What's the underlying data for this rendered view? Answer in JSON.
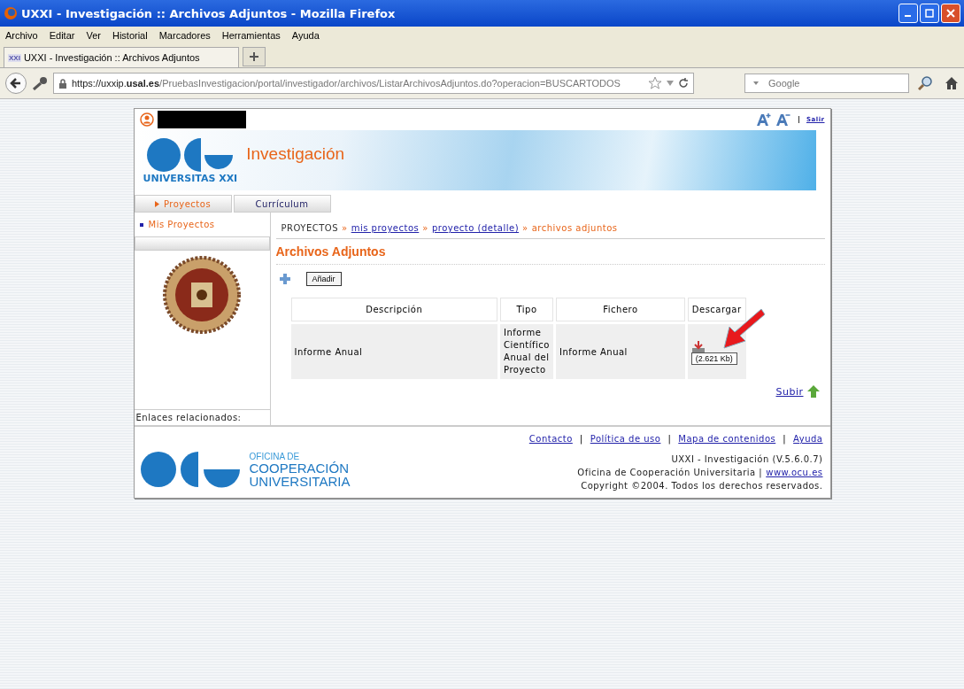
{
  "window": {
    "title": "UXXI - Investigación :: Archivos Adjuntos - Mozilla Firefox"
  },
  "menu": [
    "Archivo",
    "Editar",
    "Ver",
    "Historial",
    "Marcadores",
    "Herramientas",
    "Ayuda"
  ],
  "tabs": [
    {
      "label": "UXXI - Investigación :: Archivos Adjuntos",
      "selected": true
    }
  ],
  "tab_icon": "XXI",
  "address": {
    "prefix": "https://uxxip.",
    "domain": "usal.es",
    "path": "/PruebasInvestigacion/portal/investigador/archivos/ListarArchivosAdjuntos.do?operacion=BUSCARTODOS"
  },
  "search": {
    "placeholder": "Google"
  },
  "page": {
    "top_links": [
      "Salir"
    ],
    "banner": {
      "app_name": "Investigación",
      "logo_text": "UNIVERSITAS XXI"
    },
    "nav_tabs": [
      {
        "label": "Proyectos",
        "selected": true
      },
      {
        "label": "Currículum",
        "selected": false
      }
    ],
    "sidebar": {
      "items": [
        {
          "label": "Mis Proyectos"
        }
      ],
      "related": "Enlaces relacionados:"
    },
    "breadcrumb": [
      {
        "label": "PROYECTOS",
        "kind": "root"
      },
      {
        "label": "mis proyectos",
        "kind": "link"
      },
      {
        "label": "proyecto (detalle)",
        "kind": "link"
      },
      {
        "label": "archivos adjuntos",
        "kind": "current"
      }
    ],
    "breadcrumb_sep": "»",
    "heading": "Archivos Adjuntos",
    "add_button": "Añadir",
    "table": {
      "columns": [
        "Descripción",
        "Tipo",
        "Fichero",
        "Descargar"
      ],
      "rows": [
        {
          "description": "Informe Anual",
          "type": "Informe Científico Anual del Proyecto",
          "file": "Informe Anual",
          "size": "(2.621 Kb)"
        }
      ]
    },
    "up_link": "Subir",
    "footer": {
      "links": [
        "Contacto",
        "Política de uso",
        "Mapa de contenidos",
        "Ayuda"
      ],
      "link_sep": "|",
      "logo_lines": [
        "OFICINA DE",
        "COOPERACIÓN",
        "UNIVERSITARIA"
      ],
      "version": "UXXI - Investigación (V.5.6.0.7)",
      "org": "Oficina de Cooperación Universitaria |",
      "org_link": "www.ocu.es",
      "copyright": "Copyright ©2004. Todos los derechos reservados."
    }
  }
}
